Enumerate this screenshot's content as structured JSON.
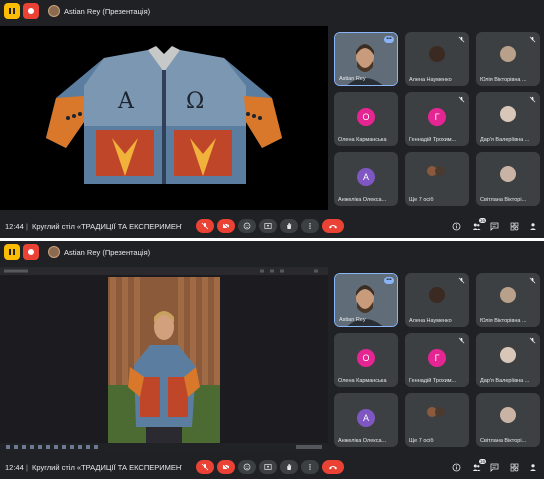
{
  "presenter_label": "Astian Rey (Презентація)",
  "meeting": {
    "time": "12:44",
    "divider": "|",
    "title": "Круглий стіл «ТРАДИЦІЇ ТА ЕКСПЕРИМЕНТИ ..."
  },
  "participants": [
    {
      "name": "Astian Rey"
    },
    {
      "name": "Алена Науменко"
    },
    {
      "name": "Юлія Вікторівна ..."
    },
    {
      "name": "Олена Карманська",
      "initial": "О",
      "color": "#e52592"
    },
    {
      "name": "Геннадій Трохим...",
      "initial": "Г",
      "color": "#e52592"
    },
    {
      "name": "Дар'я Валеріївна ..."
    },
    {
      "name": "Анжеліка Олекса...",
      "initial": "А",
      "color": "#7e57c2"
    },
    {
      "name": "Ще 7 осіб"
    },
    {
      "name": "Світлана Вікторі..."
    }
  ],
  "people_count": "16",
  "accent_color": "#8ab4f8",
  "danger_color": "#ea4335"
}
